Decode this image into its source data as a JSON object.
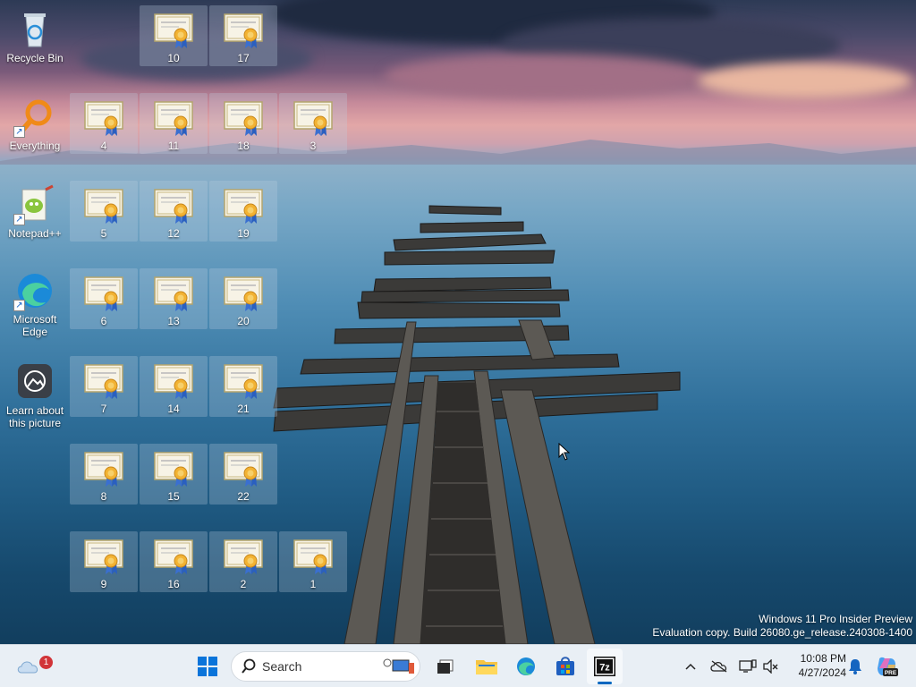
{
  "desktop": {
    "system_icons": [
      {
        "label": "Recycle Bin",
        "icon": "recycle-bin-icon"
      },
      {
        "label": "Everything",
        "icon": "everything-search-icon"
      },
      {
        "label": "Notepad++",
        "icon": "notepadpp-icon"
      },
      {
        "label": "Microsoft Edge",
        "icon": "edge-icon"
      },
      {
        "label": "Learn about this picture",
        "icon": "camera-icon"
      }
    ],
    "certificate_files": [
      "10",
      "17",
      "4",
      "11",
      "18",
      "3",
      "5",
      "12",
      "19",
      "6",
      "13",
      "20",
      "7",
      "14",
      "21",
      "8",
      "15",
      "22",
      "9",
      "16",
      "2",
      "1"
    ],
    "watermark": {
      "line1": "Windows 11 Pro Insider Preview",
      "line2": "Evaluation copy. Build 26080.ge_release.240308-1400"
    }
  },
  "taskbar": {
    "widgets_badge": "1",
    "search_placeholder": "Search",
    "apps": [
      "file-explorer-icon",
      "edge-icon",
      "microsoft-store-icon",
      "7zip-icon"
    ],
    "clock_time": "10:08 PM",
    "clock_date": "4/27/2024",
    "copilot_badge": "PRE"
  },
  "colors": {
    "accent": "#0067c0",
    "taskbar_bg": "#e9eff5",
    "notification_red": "#d13438"
  }
}
